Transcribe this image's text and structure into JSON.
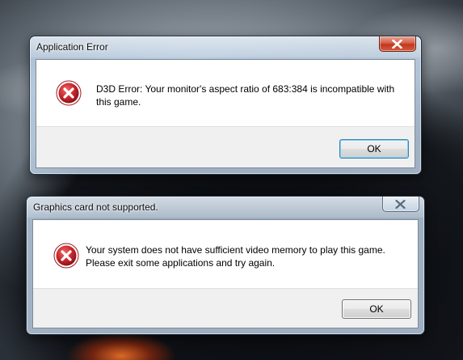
{
  "dialogs": [
    {
      "title": "Application Error",
      "message_line1": "D3D Error: Your monitor's aspect ratio of 683:384 is incompatible with",
      "message_line2": "this game.",
      "button_label": "OK",
      "icon": "error-icon",
      "close_icon": "close-icon"
    },
    {
      "title": "Graphics card not supported.",
      "message_line1": "Your system does not have sufficient video memory to play this game.",
      "message_line2": "Please exit some applications and try again.",
      "button_label": "OK",
      "icon": "error-icon",
      "close_icon": "close-icon"
    }
  ],
  "colors": {
    "error_icon": "#c8262d",
    "close_button": "#c2361d",
    "glass_frame": "#bed3e8"
  }
}
